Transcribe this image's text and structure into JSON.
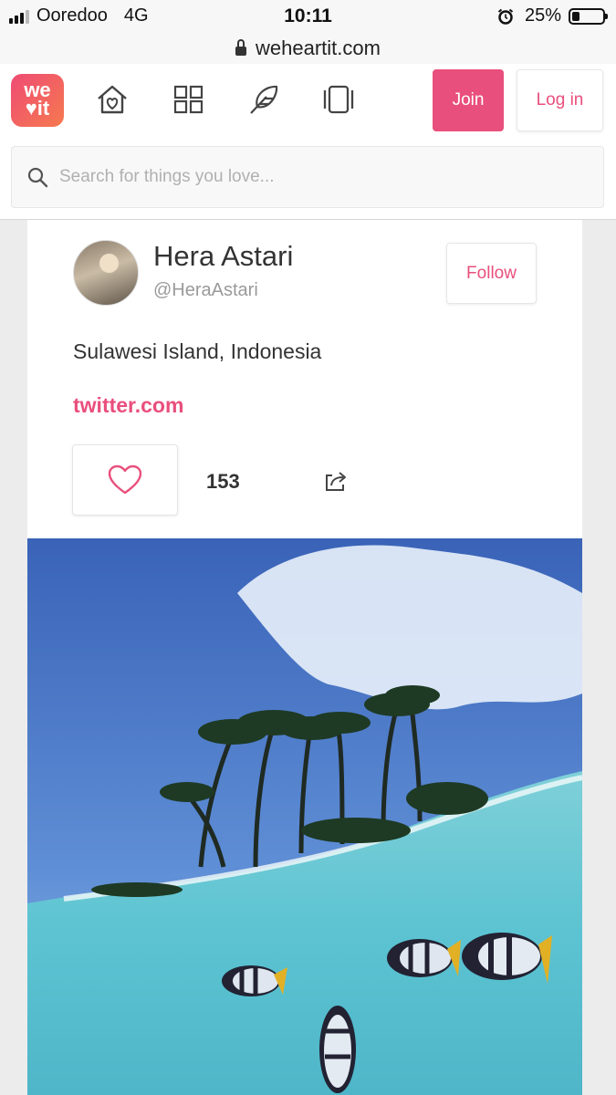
{
  "status_bar": {
    "carrier": "Ooredoo",
    "network": "4G",
    "time": "10:11",
    "battery_percent": "25%",
    "battery_level": 0.25
  },
  "browser": {
    "url": "weheartit.com"
  },
  "nav": {
    "logo_line1": "we",
    "logo_line2": "♥it",
    "icons": [
      "home-heart-icon",
      "grid-icon",
      "feather-icon",
      "collections-icon"
    ],
    "join_label": "Join",
    "login_label": "Log in"
  },
  "search": {
    "placeholder": "Search for things you love..."
  },
  "profile": {
    "name": "Hera Astari",
    "handle": "@HeraAstari",
    "follow_label": "Follow",
    "location": "Sulawesi Island, Indonesia",
    "link": "twitter.com",
    "like_count": "153"
  },
  "colors": {
    "accent": "#e94f7c",
    "logo_gradient_start": "#ee4c74",
    "logo_gradient_end": "#f6794f"
  }
}
